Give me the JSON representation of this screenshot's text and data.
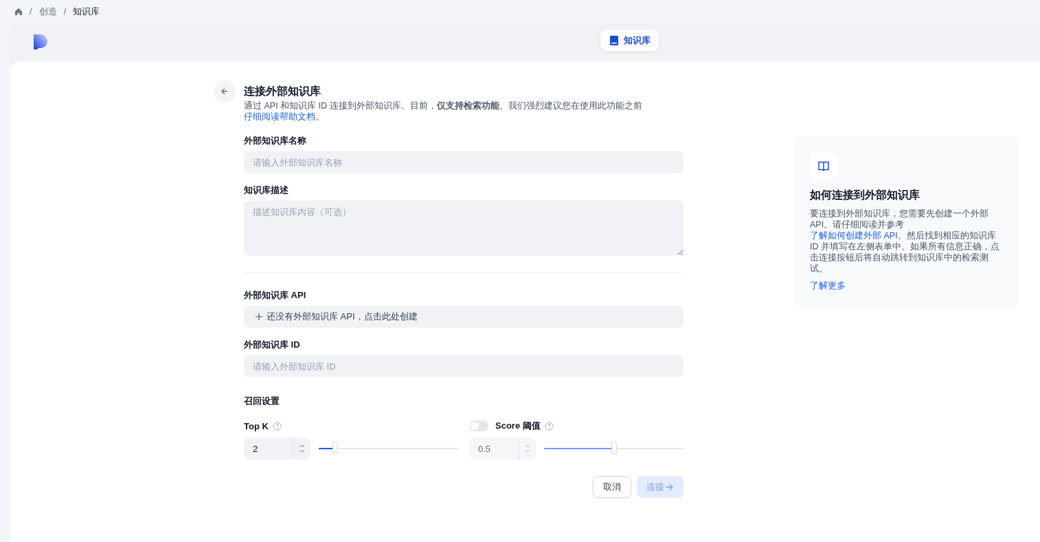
{
  "breadcrumb": [
    "创造",
    "知识库"
  ],
  "breadcrumb_separators": [
    "/",
    "/"
  ],
  "header": {
    "tab": {
      "label": "知识库",
      "selected": true
    }
  },
  "form": {
    "title": "连接外部知识库",
    "description": {
      "before": "通过 API 和知识库 ID 连接到外部知识库。目前，**仅支持检索功能**。我们强烈建议您在使用此功能之前",
      "link": "仔细阅读帮助文档",
      "after": "。"
    },
    "name_field": {
      "label": "外部知识库名称",
      "placeholder": "请输入外部知识库名称"
    },
    "desc_field": {
      "label": "知识库描述",
      "placeholder": "描述知识库内容（可选）"
    },
    "api_field": {
      "label": "外部知识库 API",
      "value": "还没有外部知识库 API，点击此处创建"
    },
    "id_field": {
      "label": "外部知识库 ID",
      "placeholder": "请输入外部知识库 ID"
    },
    "recall": {
      "title": "召回设置",
      "top_k": {
        "label": "Top K",
        "value": "2",
        "level": 0.12
      },
      "score": {
        "label": "Score 阈值",
        "on": false,
        "value": "0.5",
        "level": 0.5
      }
    },
    "buttons": {
      "cancel": "取消",
      "connect": {
        "label": "连接",
        "disabled": true
      }
    }
  },
  "help_card": {
    "title": "如何连接到外部知识库",
    "before": "要连接到外部知识库，您需要先创建一个外部 API。请仔细阅读并参考 ",
    "link": "了解如何创建外部 API",
    "after": "。然后找到相应的知识库 ID 并填写在左侧表单中。如果所有信息正确，点击连接按钮后将自动跳转到知识库中的检索测试。",
    "more": "了解更多"
  }
}
